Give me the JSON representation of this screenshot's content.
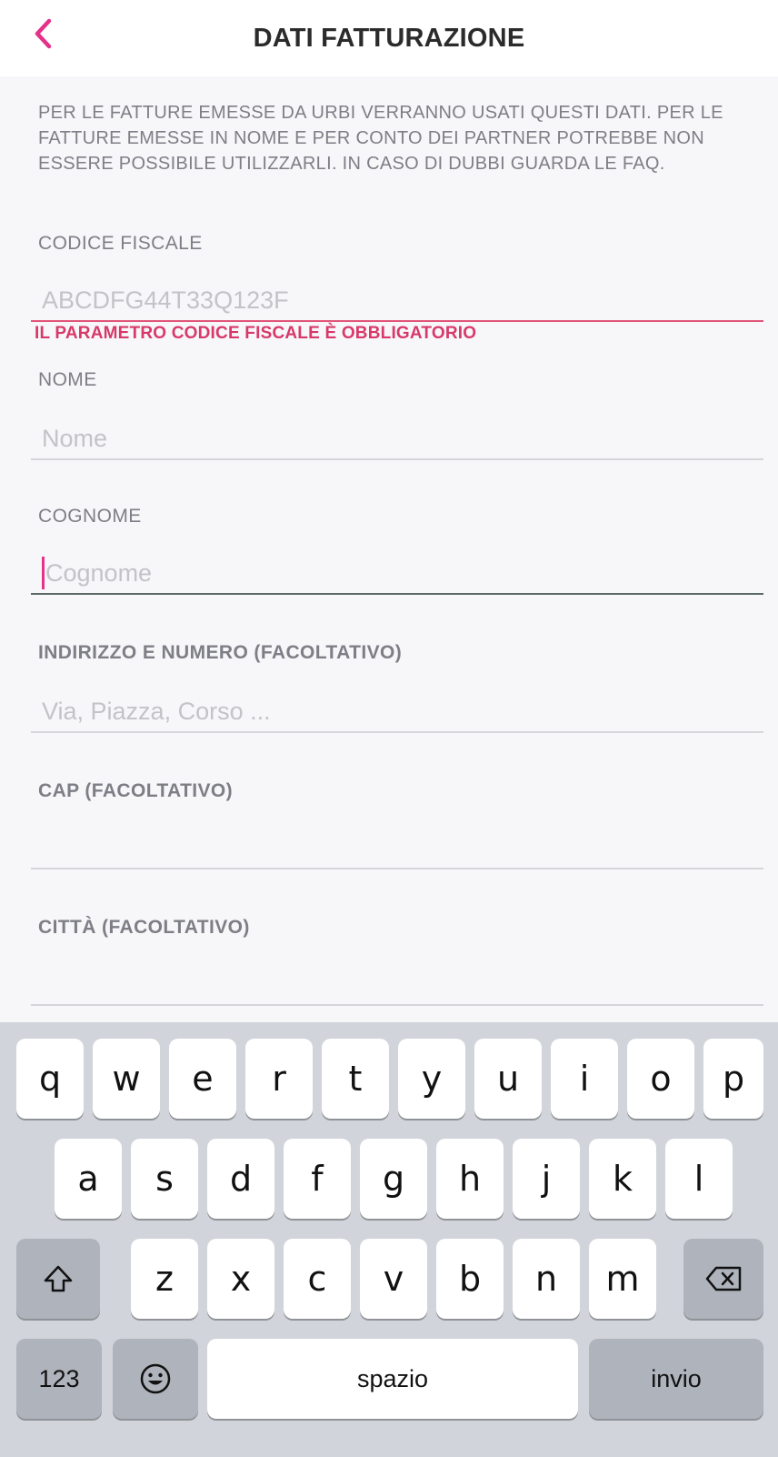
{
  "header": {
    "back_icon": "chevron-left-icon",
    "title": "DATI FATTURAZIONE",
    "accent_color": "#e4318a"
  },
  "intro_text": "PER LE FATTURE EMESSE DA URBI VERRANNO USATI QUESTI DATI. PER LE FATTURE EMESSE IN NOME E PER CONTO DEI PARTNER POTREBBE NON ESSERE POSSIBILE UTILIZZARLI. IN CASO DI DUBBI GUARDA LE FAQ.",
  "form": {
    "codice_fiscale": {
      "label": "CODICE FISCALE",
      "placeholder": "ABCDFG44T33Q123F",
      "value": "",
      "error": "IL PARAMETRO CODICE FISCALE È OBBLIGATORIO"
    },
    "nome": {
      "label": "NOME",
      "placeholder": "Nome",
      "value": ""
    },
    "cognome": {
      "label": "COGNOME",
      "placeholder": "Cognome",
      "value": ""
    },
    "indirizzo": {
      "label": "INDIRIZZO E NUMERO (FACOLTATIVO)",
      "placeholder": "Via, Piazza, Corso ...",
      "value": ""
    },
    "cap": {
      "label": "CAP (FACOLTATIVO)",
      "placeholder": "",
      "value": ""
    },
    "citta": {
      "label": "CITTÀ (FACOLTATIVO)",
      "placeholder": "",
      "value": ""
    },
    "error_color": "#d8396a"
  },
  "keyboard": {
    "row1": [
      "q",
      "w",
      "e",
      "r",
      "t",
      "y",
      "u",
      "i",
      "o",
      "p"
    ],
    "row2": [
      "a",
      "s",
      "d",
      "f",
      "g",
      "h",
      "j",
      "k",
      "l"
    ],
    "row3": [
      "z",
      "x",
      "c",
      "v",
      "b",
      "n",
      "m"
    ],
    "shift_icon": "shift-icon",
    "delete_icon": "delete-icon",
    "numbers_label": "123",
    "emoji_icon": "emoji-icon",
    "space_label": "spazio",
    "return_label": "invio"
  }
}
